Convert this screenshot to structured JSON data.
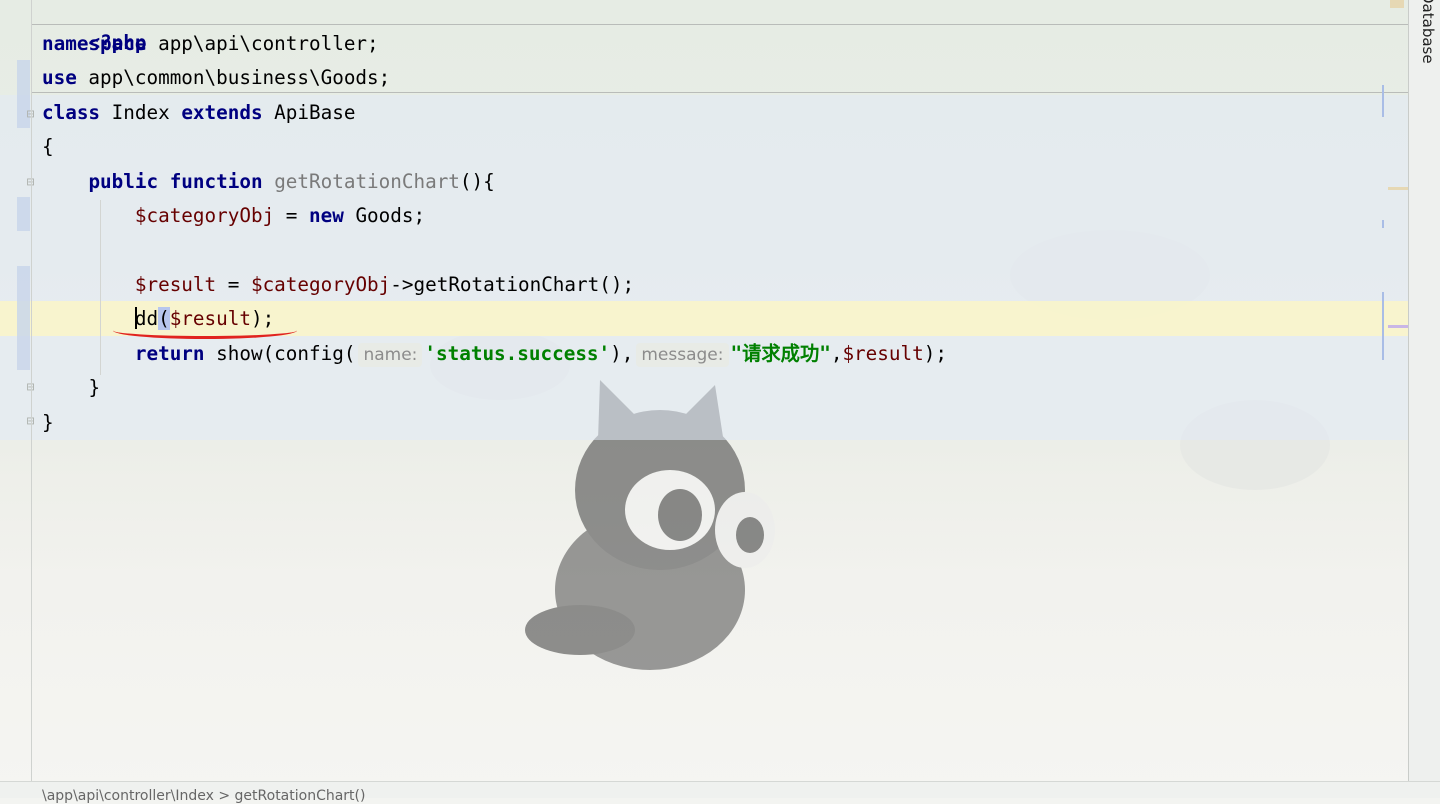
{
  "code": {
    "php_open": "<?php",
    "namespace_kw": "namespace",
    "namespace_value": " app\\api\\controller;",
    "use_kw": "use",
    "use_value": " app\\common\\business\\Goods;",
    "class_kw": "class",
    "class_name": " Index ",
    "extends_kw": "extends",
    "base_class": " ApiBase",
    "open_brace": "{",
    "public_kw": "public",
    "function_kw": "function",
    "method_name": "getRotationChart",
    "method_tail": "(){",
    "var_category": "$categoryObj",
    "assign_eq": " = ",
    "new_kw": "new",
    "goods_class": " Goods;",
    "var_result": "$result",
    "var_category_ref": "$categoryObj",
    "method_call": "->getRotationChart();",
    "dd_prefix": "dd",
    "dd_open": "(",
    "dd_arg": "$result",
    "dd_close": ");",
    "return_kw": "return",
    "return_call": " show(config(",
    "hint_name": "name:",
    "str_status": "'status.success'",
    "return_mid": "),",
    "hint_message": "message:",
    "str_message": "\"请求成功\"",
    "return_tail_comma": ",",
    "return_tail_var": "$result",
    "return_tail_end": ");",
    "method_close": "}",
    "class_close": "}"
  },
  "side_panel": {
    "label": "Database"
  },
  "status_bar": {
    "breadcrumb": "\\app\\api\\controller\\Index > getRotationChart()"
  },
  "colors": {
    "keyword": "#000080",
    "variable": "#660000",
    "string": "#008000",
    "current_line": "#fbf7c8",
    "annotation_red": "#e1231e"
  }
}
